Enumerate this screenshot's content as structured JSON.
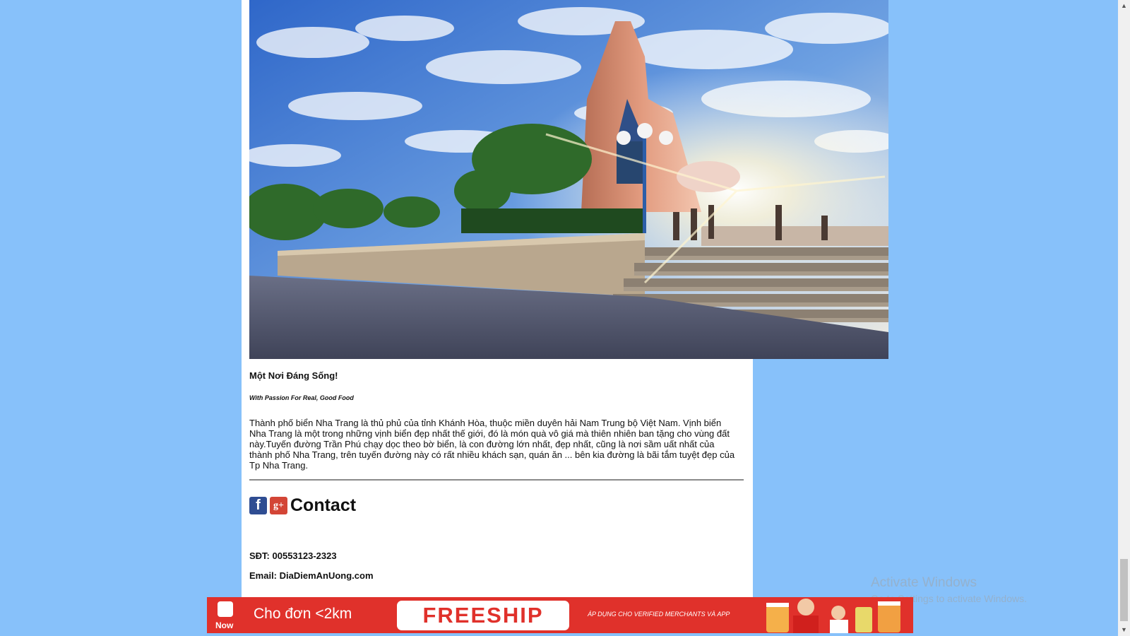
{
  "hero": {
    "image": "nha-trang-tower-image"
  },
  "article": {
    "headline": "Một Nơi Đáng Sống!",
    "tagline": "With Passion For Real, Good Food",
    "description": "Thành phố biển Nha Trang là thủ phủ của tỉnh Khánh Hòa, thuộc miền duyên hải Nam Trung bộ Việt Nam. Vịnh biển Nha Trang là một trong những vịnh biển đẹp nhất thế giới, đó là món quà vô giá mà thiên nhiên ban tặng cho vùng đất này.Tuyến đường Trần Phú chạy dọc theo bờ biển, là con đường lớn nhất, đẹp nhất, cũng là nơi sầm uất nhất của thành phố Nha Trang, trên tuyến đường này có rất nhiều khách sạn, quán ăn ... bên kia đường là bãi tắm tuyệt đẹp của Tp Nha Trang."
  },
  "contact": {
    "facebook_icon": "f",
    "googleplus_icon": "g+",
    "title": "Contact",
    "phone": "SĐT: 00553123-2323",
    "email": "Email: DiaDiemAnUong.com"
  },
  "banner": {
    "badge_label": "Now",
    "lead_text": "Cho đơn <2km",
    "button_label": "FREESHIP",
    "note": "ÁP DỤNG CHO VERIFIED MERCHANTS VÀ APP"
  },
  "windows_watermark": {
    "title": "Activate Windows",
    "subtitle": "Go to Settings to activate Windows."
  },
  "colors": {
    "page_background": "#87c1fa",
    "banner_red": "#e0312b",
    "facebook_blue": "#2f4d92",
    "googleplus_red": "#d34536"
  }
}
